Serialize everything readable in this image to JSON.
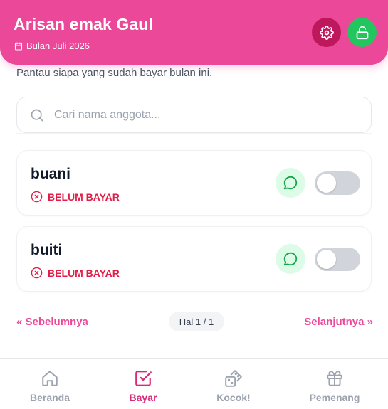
{
  "header": {
    "title": "Arisan emak Gaul",
    "period": "Bulan Juli 2026"
  },
  "intro": "Pantau siapa yang sudah bayar bulan ini.",
  "search": {
    "placeholder": "Cari nama anggota..."
  },
  "members": [
    {
      "name": "buani",
      "status": "BELUM BAYAR",
      "paid": false
    },
    {
      "name": "buiti",
      "status": "BELUM BAYAR",
      "paid": false
    }
  ],
  "pagination": {
    "prev_label": "« Sebelumnya",
    "page_label": "Hal 1 / 1",
    "next_label": "Selanjutnya »"
  },
  "nav": [
    {
      "label": "Beranda",
      "icon": "home-icon",
      "active": false
    },
    {
      "label": "Bayar",
      "icon": "checkbox-icon",
      "active": true
    },
    {
      "label": "Kocok!",
      "icon": "dice-icon",
      "active": false
    },
    {
      "label": "Pemenang",
      "icon": "gift-icon",
      "active": false
    }
  ],
  "colors": {
    "primary": "#ec4899",
    "settings_button": "#be185d",
    "lock_button": "#22c55e",
    "unpaid": "#e11d48",
    "whatsapp_bg": "#dcfce7",
    "whatsapp": "#16a34a"
  }
}
